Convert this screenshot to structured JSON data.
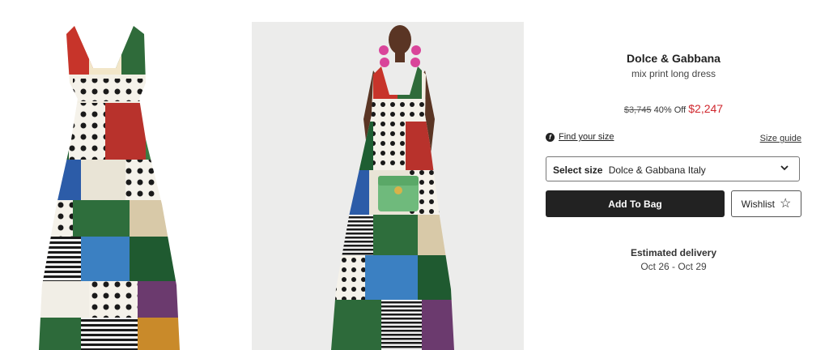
{
  "product": {
    "brand": "Dolce & Gabbana",
    "name": "mix print long dress",
    "original_price": "$3,745",
    "discount": "40% Off",
    "sale_price": "$2,247"
  },
  "sizing": {
    "find_size_label": "Find your size",
    "size_guide_label": "Size guide",
    "select_label": "Select size",
    "select_value": "Dolce & Gabbana Italy"
  },
  "actions": {
    "add_to_bag": "Add To Bag",
    "wishlist": "Wishlist"
  },
  "delivery": {
    "label": "Estimated delivery",
    "range": "Oct 26 - Oct 29"
  },
  "icons": {
    "fit": "fit-icon",
    "chevron": "chevron-down-icon",
    "wishlist": "star-icon"
  },
  "colors": {
    "sale": "#d0262d",
    "primary_button": "#222222"
  }
}
